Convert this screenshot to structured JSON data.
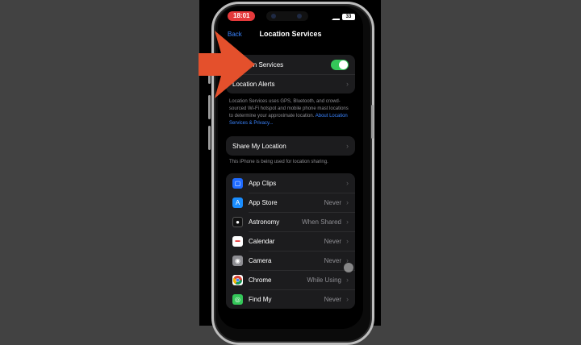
{
  "status_bar": {
    "time": "18:01",
    "battery": "33"
  },
  "nav": {
    "back_label": "Back",
    "title": "Location Services"
  },
  "location_group": {
    "location_services_label": "Location Services",
    "location_alerts_label": "Location Alerts"
  },
  "location_note": {
    "text": "Location Services uses GPS, Bluetooth, and crowd-sourced Wi-Fi hotspot and mobile phone mast locations to determine your approximate location.",
    "link": "About Location Services & Privacy..."
  },
  "share_group": {
    "label": "Share My Location"
  },
  "share_note": "This iPhone is being used for location sharing.",
  "apps": [
    {
      "label": "App Clips",
      "value": ""
    },
    {
      "label": "App Store",
      "value": "Never"
    },
    {
      "label": "Astronomy",
      "value": "When Shared"
    },
    {
      "label": "Calendar",
      "value": "Never"
    },
    {
      "label": "Camera",
      "value": "Never"
    },
    {
      "label": "Chrome",
      "value": "While Using"
    },
    {
      "label": "Find My",
      "value": "Never"
    }
  ],
  "icons": {
    "app_clips": "app-clips-icon",
    "app_store": "app-store-icon",
    "astronomy": "astronomy-icon",
    "calendar": "calendar-icon",
    "camera": "camera-icon",
    "chrome": "chrome-icon",
    "find_my": "find-my-icon"
  },
  "colors": {
    "toggle_on": "#34c759",
    "link": "#3a84ff",
    "arrow": "#e4502c",
    "time_pill": "#e5393b"
  }
}
